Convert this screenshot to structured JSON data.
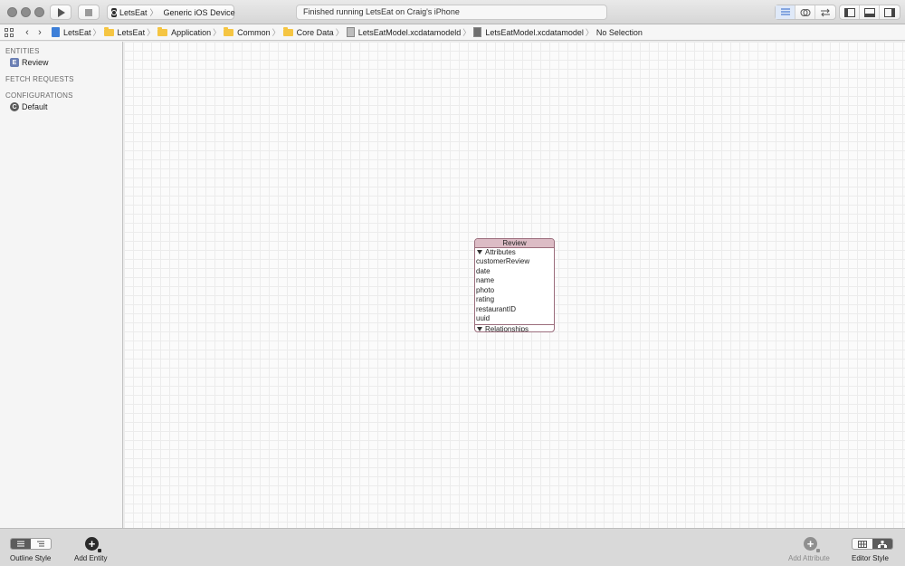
{
  "toolbar": {
    "scheme_app": "LetsEat",
    "scheme_device": "Generic iOS Device",
    "status_text": "Finished running LetsEat on Craig's iPhone"
  },
  "jumpbar": {
    "crumbs": [
      "LetsEat",
      "LetsEat",
      "Application",
      "Common",
      "Core Data",
      "LetsEatModel.xcdatamodeld",
      "LetsEatModel.xcdatamodel",
      "No Selection"
    ]
  },
  "sidebar": {
    "entities_header": "ENTITIES",
    "entities": [
      "Review"
    ],
    "fetch_requests_header": "FETCH REQUESTS",
    "configurations_header": "CONFIGURATIONS",
    "configurations": [
      "Default"
    ],
    "entity_badge": "E",
    "configuration_badge": "C"
  },
  "diagram": {
    "entity_name": "Review",
    "attributes_label": "Attributes",
    "attributes": [
      "customerReview",
      "date",
      "name",
      "photo",
      "rating",
      "restaurantID",
      "uuid"
    ],
    "relationships_label": "Relationships"
  },
  "bottombar": {
    "outline_style_label": "Outline Style",
    "add_entity_label": "Add Entity",
    "add_attribute_label": "Add Attribute",
    "editor_style_label": "Editor Style"
  },
  "colors": {
    "entity_header": "#dcbcc5",
    "entity_border": "#9b6d7c",
    "folder": "#f5c542"
  }
}
